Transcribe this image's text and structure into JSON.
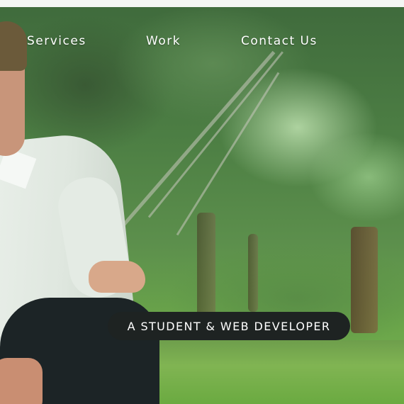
{
  "nav": {
    "items": [
      {
        "label": "Services"
      },
      {
        "label": "Work"
      },
      {
        "label": "Contact Us"
      }
    ]
  },
  "hero": {
    "tagline": "A STUDENT & WEB DEVELOPER"
  },
  "colors": {
    "nav_text": "#ffffff",
    "badge_bg": "#1e2322",
    "badge_text": "#ffffff"
  }
}
